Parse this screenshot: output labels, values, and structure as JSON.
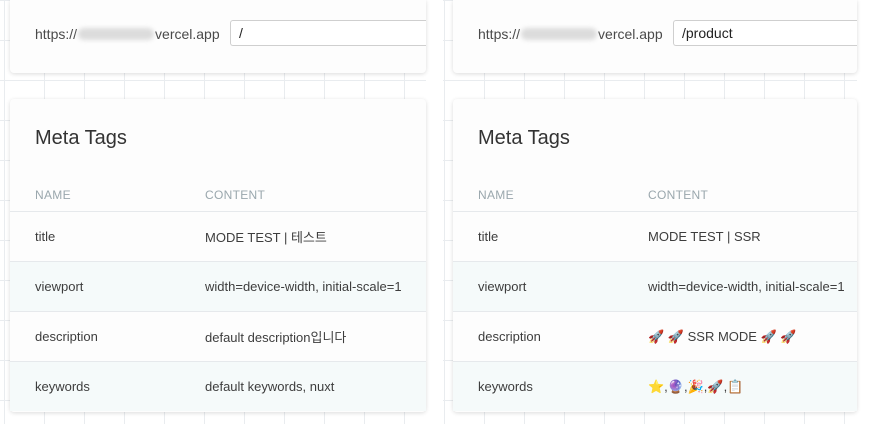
{
  "left": {
    "url": {
      "prefix": "https://",
      "suffix": "vercel.app",
      "path": "/"
    },
    "meta": {
      "title": "Meta Tags",
      "headers": {
        "name": "NAME",
        "content": "CONTENT"
      },
      "rows": [
        {
          "name": "title",
          "content": "MODE TEST | 테스트"
        },
        {
          "name": "viewport",
          "content": "width=device-width, initial-scale=1"
        },
        {
          "name": "description",
          "content": "default description입니다"
        },
        {
          "name": "keywords",
          "content": "default keywords, nuxt"
        }
      ]
    }
  },
  "right": {
    "url": {
      "prefix": "https://",
      "suffix": "vercel.app",
      "path": "/product"
    },
    "meta": {
      "title": "Meta Tags",
      "headers": {
        "name": "NAME",
        "content": "CONTENT"
      },
      "rows": [
        {
          "name": "title",
          "content": "MODE TEST | SSR"
        },
        {
          "name": "viewport",
          "content": "width=device-width, initial-scale=1"
        },
        {
          "name": "description",
          "content": "🚀 🚀 SSR MODE 🚀 🚀"
        },
        {
          "name": "keywords",
          "content": "⭐,🔮,🎉,🚀,📋"
        }
      ]
    }
  }
}
